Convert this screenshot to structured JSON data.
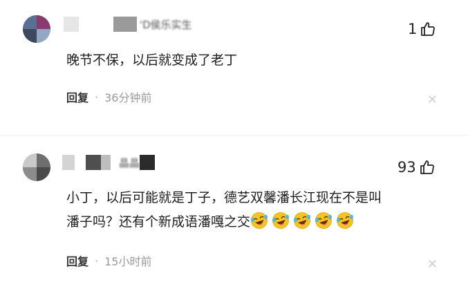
{
  "comments": [
    {
      "username": "'D侯乐实生",
      "likes": "1",
      "text": "晚节不保，以后就变成了老丁",
      "reply_label": "回复",
      "time": "36分钟前",
      "emoji_count": 0
    },
    {
      "username": "晶晶",
      "likes": "93",
      "text_line1": "小丁，以后可能就是丁子，德艺双馨潘长江现在不是叫",
      "text_line2": "潘子吗？还有个新成语潘嘎之交",
      "reply_label": "回复",
      "time": "15小时前",
      "emoji_count": 5
    }
  ],
  "icons": {
    "like": "thumbs-up-icon",
    "close": "close-icon",
    "emoji": "rofl-emoji-icon"
  },
  "colors": {
    "text": "#1d1d1d",
    "meta": "#999999",
    "reply": "#333333",
    "emoji_face": "#f7c51e"
  }
}
